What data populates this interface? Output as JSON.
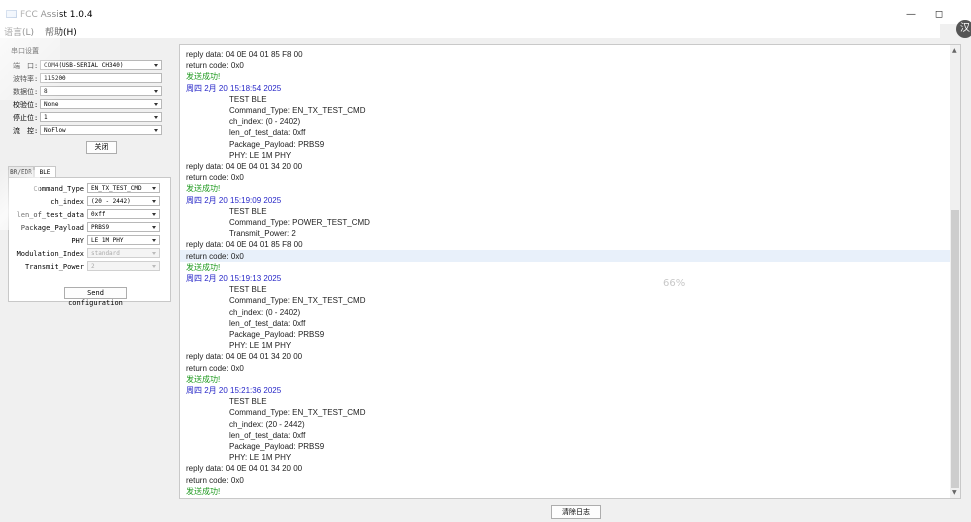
{
  "window": {
    "title": "FCC Assist 1.0.4",
    "minimize": "—",
    "maximize": "◻",
    "badge": "汉"
  },
  "menu": {
    "language": "语言(L)",
    "help": "帮助(H)"
  },
  "serial": {
    "group_title": "串口设置",
    "port_label": "端　口:",
    "port_value": "COM4(USB-SERIAL CH340)",
    "baud_label": "波特率:",
    "baud_value": "115200",
    "databits_label": "数据位:",
    "databits_value": "8",
    "parity_label": "校验位:",
    "parity_value": "None",
    "stopbits_label": "停止位:",
    "stopbits_value": "1",
    "flow_label": "流　控:",
    "flow_value": "NoFlow",
    "close_button": "关闭"
  },
  "tabs": {
    "br_edr": "BR/EDR",
    "ble": "BLE"
  },
  "ble": {
    "command_type_label": "Command_Type",
    "command_type_value": "EN_TX_TEST_CMD",
    "ch_index_label": "ch_index",
    "ch_index_value": "(20 - 2442)",
    "len_label": "len_of_test_data",
    "len_value": "0xff",
    "payload_label": "Package_Payload",
    "payload_value": "PRBS9",
    "phy_label": "PHY",
    "phy_value": "LE 1M PHY",
    "modulation_label": "Modulation_Index",
    "modulation_value": "standard",
    "transmit_power_label": "Transmit_Power",
    "transmit_power_value": "2",
    "send_button": "Send configuration"
  },
  "log": [
    {
      "text": "reply data: 04 0E 04 01 85 F8 00",
      "color": "black",
      "indent": false
    },
    {
      "text": "return code: 0x0",
      "color": "black",
      "indent": false
    },
    {
      "text": "发送成功!",
      "color": "green",
      "indent": false
    },
    {
      "text": "周四 2月 20 15:18:54 2025",
      "color": "blue",
      "indent": false
    },
    {
      "text": "TEST BLE",
      "color": "black",
      "indent": true
    },
    {
      "text": "Command_Type: EN_TX_TEST_CMD",
      "color": "black",
      "indent": true
    },
    {
      "text": "ch_index: (0 - 2402)",
      "color": "black",
      "indent": true
    },
    {
      "text": "len_of_test_data: 0xff",
      "color": "black",
      "indent": true
    },
    {
      "text": "Package_Payload: PRBS9",
      "color": "black",
      "indent": true
    },
    {
      "text": "PHY: LE 1M PHY",
      "color": "black",
      "indent": true
    },
    {
      "text": "reply data: 04 0E 04 01 34 20 00",
      "color": "black",
      "indent": false
    },
    {
      "text": "return code: 0x0",
      "color": "black",
      "indent": false
    },
    {
      "text": "发送成功!",
      "color": "green",
      "indent": false
    },
    {
      "text": "周四 2月 20 15:19:09 2025",
      "color": "blue",
      "indent": false
    },
    {
      "text": "TEST BLE",
      "color": "black",
      "indent": true
    },
    {
      "text": "Command_Type: POWER_TEST_CMD",
      "color": "black",
      "indent": true
    },
    {
      "text": "Transmit_Power: 2",
      "color": "black",
      "indent": true
    },
    {
      "text": "reply data: 04 0E 04 01 85 F8 00",
      "color": "black",
      "indent": false
    },
    {
      "text": "return code: 0x0",
      "color": "black",
      "indent": false
    },
    {
      "text": "发送成功!",
      "color": "green",
      "indent": false
    },
    {
      "text": "周四 2月 20 15:19:13 2025",
      "color": "blue",
      "indent": false
    },
    {
      "text": "TEST BLE",
      "color": "black",
      "indent": true
    },
    {
      "text": "Command_Type: EN_TX_TEST_CMD",
      "color": "black",
      "indent": true
    },
    {
      "text": "ch_index: (0 - 2402)",
      "color": "black",
      "indent": true
    },
    {
      "text": "len_of_test_data: 0xff",
      "color": "black",
      "indent": true
    },
    {
      "text": "Package_Payload: PRBS9",
      "color": "black",
      "indent": true
    },
    {
      "text": "PHY: LE 1M PHY",
      "color": "black",
      "indent": true
    },
    {
      "text": "reply data: 04 0E 04 01 34 20 00",
      "color": "black",
      "indent": false
    },
    {
      "text": "return code: 0x0",
      "color": "black",
      "indent": false
    },
    {
      "text": "发送成功!",
      "color": "green",
      "indent": false
    },
    {
      "text": "周四 2月 20 15:21:36 2025",
      "color": "blue",
      "indent": false
    },
    {
      "text": "TEST BLE",
      "color": "black",
      "indent": true
    },
    {
      "text": "Command_Type: EN_TX_TEST_CMD",
      "color": "black",
      "indent": true
    },
    {
      "text": "ch_index: (20 - 2442)",
      "color": "black",
      "indent": true
    },
    {
      "text": "len_of_test_data: 0xff",
      "color": "black",
      "indent": true
    },
    {
      "text": "Package_Payload: PRBS9",
      "color": "black",
      "indent": true
    },
    {
      "text": "PHY: LE 1M PHY",
      "color": "black",
      "indent": true
    },
    {
      "text": "reply data: 04 0E 04 01 34 20 00",
      "color": "black",
      "indent": false
    },
    {
      "text": "return code: 0x0",
      "color": "black",
      "indent": false
    },
    {
      "text": "发送成功!",
      "color": "green",
      "indent": false
    }
  ],
  "progress_text": "66%",
  "clear_log_button": "清除日志",
  "colors": {
    "log_green": "#1f9a1f",
    "log_blue": "#2727c8",
    "highlight_row": "#e8f0fa"
  }
}
